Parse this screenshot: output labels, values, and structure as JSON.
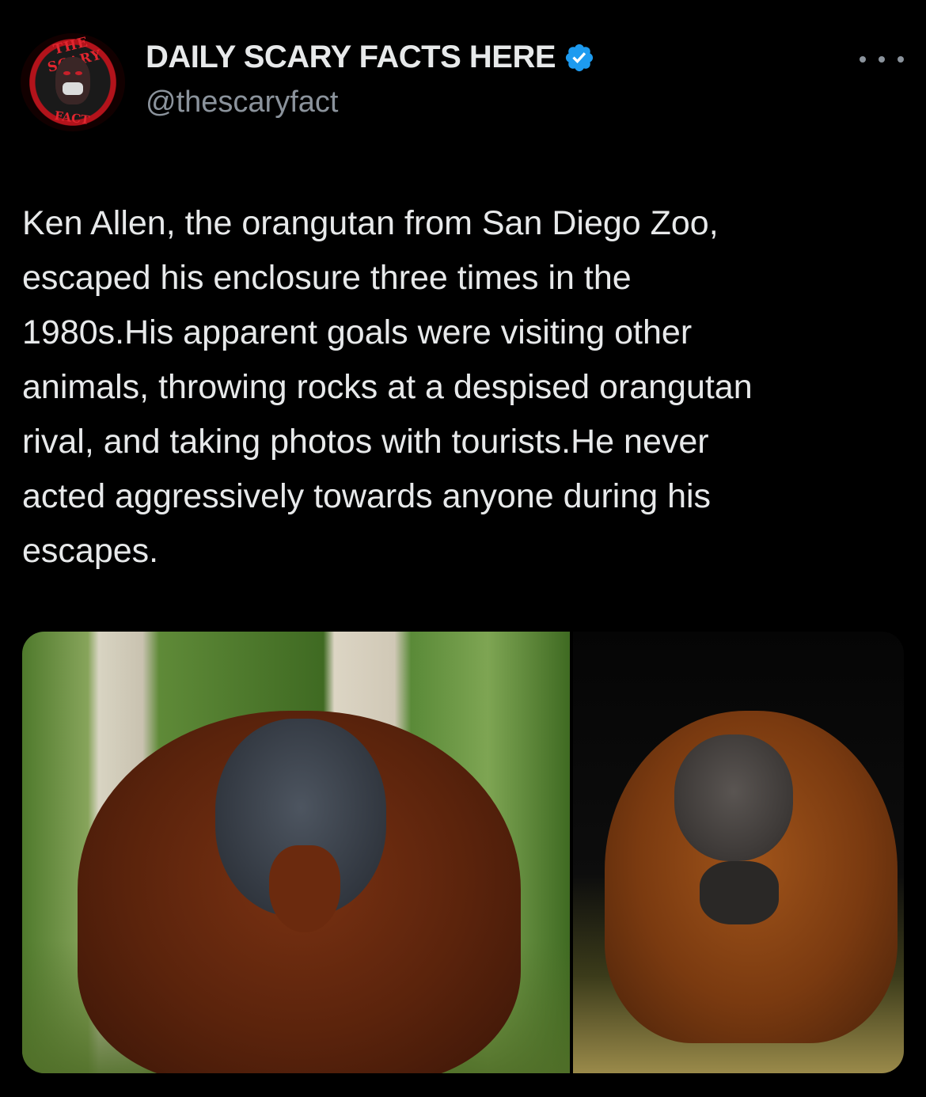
{
  "account": {
    "display_name": "DAILY SCARY FACTS HERE",
    "handle": "@thescaryfact",
    "verified": true,
    "avatar_text_top": "THE SCARY",
    "avatar_text_bottom": "FACT"
  },
  "tweet": {
    "text_lines": [
      "Ken Allen, the orangutan from San Diego Zoo,",
      "escaped his enclosure three times in the",
      "1980s.His apparent goals were visiting other",
      "animals, throwing rocks at a despised orangutan",
      "rival, and taking photos with tourists.He never",
      "acted aggressively towards anyone during his",
      "escapes."
    ]
  },
  "media": {
    "photo_count": 2,
    "photos": [
      {
        "subject": "orangutan sitting on grass among trees"
      },
      {
        "subject": "orangutan with long orange hair on dark background"
      }
    ]
  },
  "icons": {
    "verified_badge": "verified-badge-icon",
    "more": "more-options-icon"
  },
  "colors": {
    "background": "#000000",
    "text_primary": "#e7e9ea",
    "text_secondary": "#8b939c",
    "verified_blue": "#1d9bf0"
  }
}
